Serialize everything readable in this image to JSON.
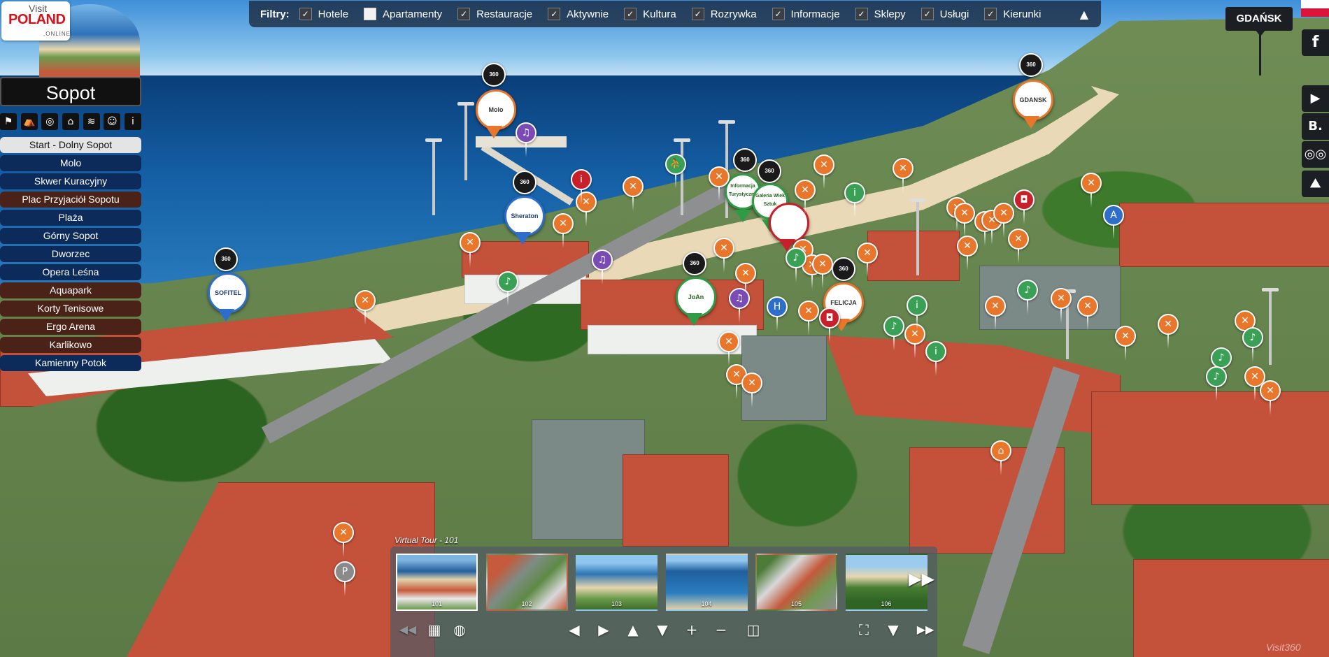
{
  "logo": {
    "line1": "Visit",
    "line2": "POLAND",
    "line3": ".ONLINE"
  },
  "city_title": "Sopot",
  "category_icons": [
    "signpost-icon",
    "bed-icon",
    "restaurant-icon",
    "museum-icon",
    "swimming-icon",
    "theatre-masks-icon",
    "info-icon"
  ],
  "category_glyphs": [
    "⚑",
    "⛺",
    "◎",
    "⌂",
    "≋",
    "☺",
    "i"
  ],
  "menu": {
    "items": [
      {
        "label": "Start - Dolny Sopot",
        "active": true
      },
      {
        "label": "Molo"
      },
      {
        "label": "Skwer Kuracyjny"
      },
      {
        "label": "Plac Przyjaciół Sopotu"
      },
      {
        "label": "Plaża"
      },
      {
        "label": "Górny Sopot"
      },
      {
        "label": "Dworzec"
      },
      {
        "label": "Opera Leśna"
      },
      {
        "label": "Aquapark"
      },
      {
        "label": "Korty Tenisowe"
      },
      {
        "label": "Ergo Arena"
      },
      {
        "label": "Karlikowo"
      },
      {
        "label": "Kamienny Potok"
      }
    ]
  },
  "filters": {
    "title": "Filtry:",
    "items": [
      {
        "label": "Hotele",
        "checked": true
      },
      {
        "label": "Apartamenty",
        "checked": false
      },
      {
        "label": "Restauracje",
        "checked": true
      },
      {
        "label": "Aktywnie",
        "checked": true
      },
      {
        "label": "Kultura",
        "checked": true
      },
      {
        "label": "Rozrywka",
        "checked": true
      },
      {
        "label": "Informacje",
        "checked": true
      },
      {
        "label": "Sklepy",
        "checked": true
      },
      {
        "label": "Usługi",
        "checked": true
      },
      {
        "label": "Kierunki",
        "checked": true
      }
    ],
    "collapse_glyph": "▲"
  },
  "direction": {
    "label": "GDAŃSK"
  },
  "social": [
    {
      "name": "facebook-icon",
      "glyph": "f"
    },
    {
      "name": "youtube-icon",
      "glyph": "▶"
    },
    {
      "name": "booking-icon",
      "glyph": "B."
    },
    {
      "name": "tripadvisor-icon",
      "glyph": "◎◎"
    },
    {
      "name": "map-icon",
      "glyph": "⛰"
    }
  ],
  "pins": {
    "sheraton": "Sheraton",
    "sofitel": "SOFITEL",
    "felicia": "FELICJA",
    "info": "Informacja Turystyczna",
    "gallery": "Galeria Wiek Sztuk",
    "joy": "JoAn",
    "molo": "Molo",
    "gdansk_pin": "GDANSK"
  },
  "pano_label": "360",
  "tour": {
    "label": "Virtual Tour - 101",
    "thumbnails": [
      {
        "label": "101",
        "selected": true
      },
      {
        "label": "102"
      },
      {
        "label": "103"
      },
      {
        "label": "104"
      },
      {
        "label": "105"
      },
      {
        "label": "106"
      }
    ],
    "next_glyph": "▶▶"
  },
  "controls": [
    {
      "name": "prev-tour-button",
      "glyph": "◀◀",
      "dim": true
    },
    {
      "name": "thumbnails-grid-button",
      "glyph": "▦"
    },
    {
      "name": "globe-button",
      "glyph": "◍"
    },
    {
      "name": "pan-left-button",
      "glyph": "◀"
    },
    {
      "name": "pan-right-button",
      "glyph": "▶"
    },
    {
      "name": "pan-up-button",
      "glyph": "▲"
    },
    {
      "name": "pan-down-button",
      "glyph": "▼"
    },
    {
      "name": "zoom-in-button",
      "glyph": "+"
    },
    {
      "name": "zoom-out-button",
      "glyph": "−"
    },
    {
      "name": "vr-button",
      "glyph": "◫"
    },
    {
      "name": "fullscreen-button",
      "glyph": "⛶"
    },
    {
      "name": "hide-panel-button",
      "glyph": "▼"
    },
    {
      "name": "next-tour-button",
      "glyph": "▶▶"
    }
  ],
  "watermark": "Visit360"
}
